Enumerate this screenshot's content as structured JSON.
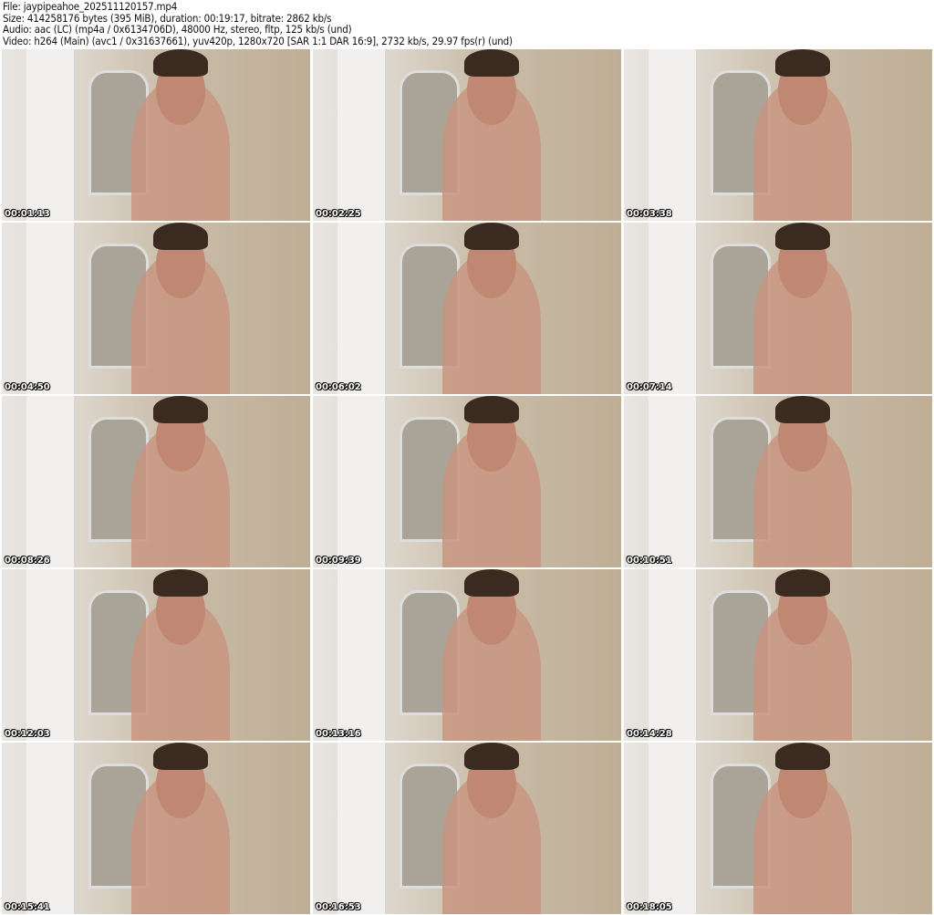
{
  "header": {
    "file": "File: jaypipeahoe_202511120157.mp4",
    "size": "Size: 414258176 bytes (395 MiB), duration: 00:19:17, bitrate: 2862 kb/s",
    "audio": "Audio: aac (LC) (mp4a / 0x6134706D), 48000 Hz, stereo, fltp, 125 kb/s (und)",
    "video": "Video: h264 (Main) (avc1 / 0x31637661), yuv420p, 1280x720 [SAR 1:1 DAR 16:9], 2732 kb/s, 29.97 fps(r) (und)"
  },
  "thumbnails": [
    {
      "timestamp": "00:01:13"
    },
    {
      "timestamp": "00:02:25"
    },
    {
      "timestamp": "00:03:38"
    },
    {
      "timestamp": "00:04:50"
    },
    {
      "timestamp": "00:06:02"
    },
    {
      "timestamp": "00:07:14"
    },
    {
      "timestamp": "00:08:26"
    },
    {
      "timestamp": "00:09:39"
    },
    {
      "timestamp": "00:10:51"
    },
    {
      "timestamp": "00:12:03"
    },
    {
      "timestamp": "00:13:16"
    },
    {
      "timestamp": "00:14:28"
    },
    {
      "timestamp": "00:15:41"
    },
    {
      "timestamp": "00:16:53"
    },
    {
      "timestamp": "00:18:05"
    }
  ]
}
